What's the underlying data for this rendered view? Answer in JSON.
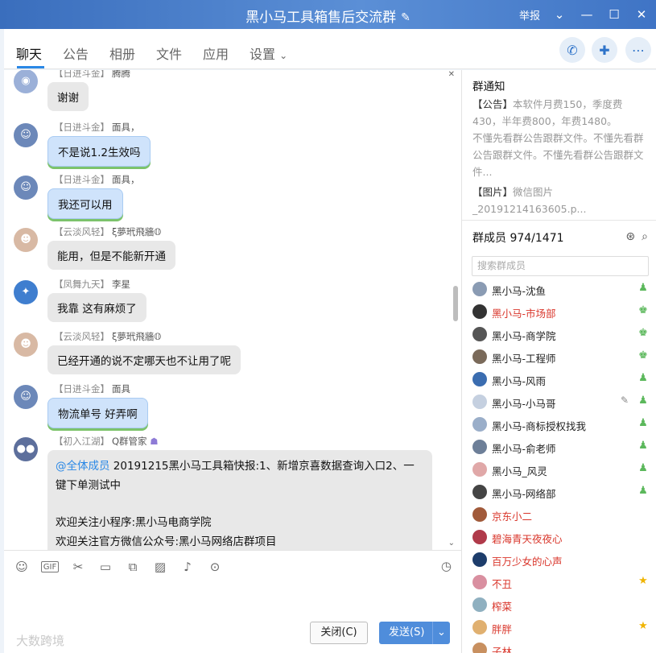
{
  "window": {
    "title": "黑小马工具箱售后交流群",
    "report_label": "举报"
  },
  "tabs": [
    "聊天",
    "公告",
    "相册",
    "文件",
    "应用",
    "设置"
  ],
  "messages": [
    {
      "level": "【日进斗金】",
      "nick": "腾腾",
      "text": "谢谢",
      "style": "gray"
    },
    {
      "level": "【日进斗金】",
      "nick": "面具，",
      "text": "不是说1.2生效吗",
      "style": "blue"
    },
    {
      "level": "【日进斗金】",
      "nick": "面具，",
      "text": "我还可以用",
      "style": "blue"
    },
    {
      "level": "【云淡风轻】",
      "nick": "ξ夢玳飛牆𝕆",
      "text": "能用，但是不能新开通",
      "style": "gray"
    },
    {
      "level": "【凤舞九天】",
      "nick": "李星",
      "text": "我靠 这有麻烦了",
      "style": "gray"
    },
    {
      "level": "【云淡风轻】",
      "nick": "ξ夢玳飛牆𝕆",
      "text": "已经开通的说不定哪天也不让用了呢",
      "style": "gray"
    },
    {
      "level": "【日进斗金】",
      "nick": "面具",
      "text": "物流单号 好弄啊",
      "style": "blue"
    }
  ],
  "bot_message": {
    "level": "【初入江湖】",
    "nick": "Q群管家",
    "mention": "@全体成员",
    "line1": " 20191215黑小马工具箱快报:1、新增京喜数据查询入口2、一键下单测试中",
    "line2": "欢迎关注小程序:黑小马电商学院",
    "line3": "欢迎关注官方微信公众号:黑小马网络店群项目"
  },
  "input": {
    "close_label": "关闭(C)",
    "send_label": "发送(S)"
  },
  "watermark": "大数跨境",
  "notice": {
    "title": "群通知",
    "tag_announcement": "【公告】",
    "announcement": "本软件月费150，季度费430，半年费800，年费1480。",
    "line2": "不懂先看群公告跟群文件。不懂先看群公告跟群文件。不懂先看群公告跟群文件...",
    "tag_image": "【图片】",
    "image_name": "微信图片_20191214163605.p..."
  },
  "members": {
    "title": "群成员 974/1471",
    "search_placeholder": "搜索群成员",
    "list": [
      {
        "name": "黑小马-沈鱼",
        "red": false,
        "badge": "admin"
      },
      {
        "name": "黑小马-市场部",
        "red": true,
        "badge": "admin-star"
      },
      {
        "name": "黑小马-商学院",
        "red": false,
        "badge": "admin-star"
      },
      {
        "name": "黑小马-工程师",
        "red": false,
        "badge": "admin-star"
      },
      {
        "name": "黑小马-风雨",
        "red": false,
        "badge": "admin"
      },
      {
        "name": "黑小马-小马哥",
        "red": false,
        "badge": "admin"
      },
      {
        "name": "黑小马-商标授权找我",
        "red": false,
        "badge": "admin"
      },
      {
        "name": "黑小马-俞老师",
        "red": false,
        "badge": "admin"
      },
      {
        "name": "黑小马_风灵",
        "red": false,
        "badge": "admin"
      },
      {
        "name": "黑小马-网络部",
        "red": false,
        "badge": "admin"
      },
      {
        "name": "京东小二",
        "red": true,
        "badge": ""
      },
      {
        "name": "碧海青天夜夜心",
        "red": true,
        "badge": ""
      },
      {
        "name": "百万少女的心声",
        "red": true,
        "badge": ""
      },
      {
        "name": "不丑",
        "red": true,
        "badge": "star"
      },
      {
        "name": "榨菜",
        "red": true,
        "badge": ""
      },
      {
        "name": "胖胖",
        "red": true,
        "badge": "star"
      },
      {
        "name": "子林",
        "red": true,
        "badge": ""
      }
    ]
  },
  "colors": {
    "accent": "#2a88e6",
    "title_bar": "#4a80cf",
    "red_name": "#d9362b"
  }
}
